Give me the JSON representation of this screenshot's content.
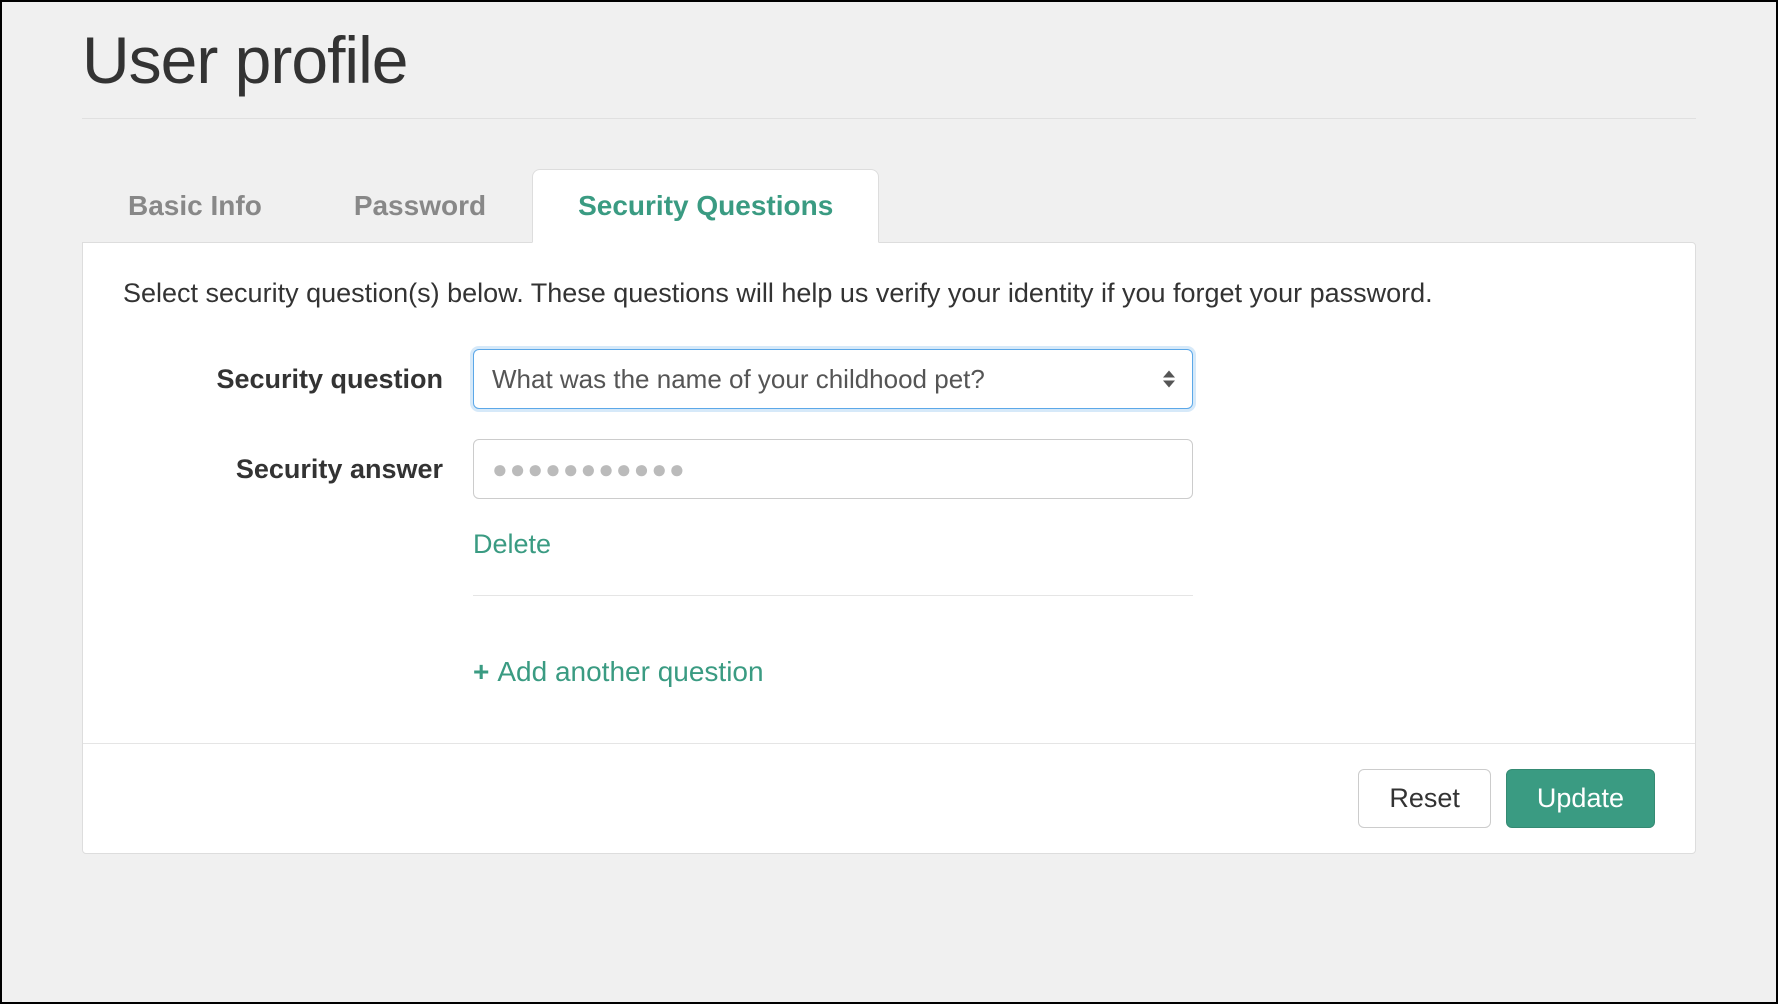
{
  "page_title": "User profile",
  "tabs": [
    {
      "label": "Basic Info",
      "active": false
    },
    {
      "label": "Password",
      "active": false
    },
    {
      "label": "Security Questions",
      "active": true
    }
  ],
  "instruction": "Select security question(s) below. These questions will help us verify your identity if you forget your password.",
  "form": {
    "question_label": "Security question",
    "question_value": "What was the name of your childhood pet?",
    "answer_label": "Security answer",
    "answer_placeholder": "●●●●●●●●●●●",
    "answer_value": "",
    "delete_label": "Delete",
    "add_label": "Add another question"
  },
  "buttons": {
    "reset": "Reset",
    "update": "Update"
  },
  "colors": {
    "accent": "#3a9b82",
    "focus": "#5ca8e8"
  }
}
